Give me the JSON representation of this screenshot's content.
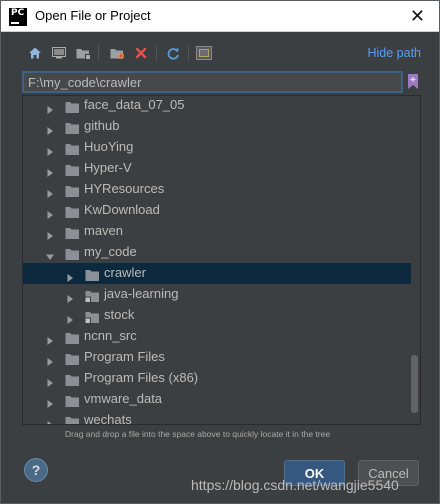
{
  "window": {
    "logo_text": "PC",
    "title": "Open File or Project"
  },
  "toolbar": {
    "icons": [
      "home-icon",
      "desktop-icon",
      "project-folder-icon",
      "new-folder-icon",
      "delete-icon",
      "refresh-icon",
      "toggle-hidden-icon"
    ],
    "hide_path_label": "Hide path"
  },
  "path": {
    "value": "F:\\my_code\\crawler"
  },
  "tree": {
    "rows": [
      {
        "label": "face_data_07_05",
        "expanded": false,
        "level": 1
      },
      {
        "label": "github",
        "expanded": false,
        "level": 1
      },
      {
        "label": "HuoYing",
        "expanded": false,
        "level": 1
      },
      {
        "label": "Hyper-V",
        "expanded": false,
        "level": 1
      },
      {
        "label": "HYResources",
        "expanded": false,
        "level": 1
      },
      {
        "label": "KwDownload",
        "expanded": false,
        "level": 1
      },
      {
        "label": "maven",
        "expanded": false,
        "level": 1
      },
      {
        "label": "my_code",
        "expanded": true,
        "level": 1
      },
      {
        "label": "crawler",
        "expanded": false,
        "level": 2,
        "selected": true
      },
      {
        "label": "java-learning",
        "expanded": false,
        "level": 2,
        "module": true
      },
      {
        "label": "stock",
        "expanded": false,
        "level": 2,
        "module": true
      },
      {
        "label": "ncnn_src",
        "expanded": false,
        "level": 1
      },
      {
        "label": "Program Files",
        "expanded": false,
        "level": 1
      },
      {
        "label": "Program Files (x86)",
        "expanded": false,
        "level": 1
      },
      {
        "label": "vmware_data",
        "expanded": false,
        "level": 1
      },
      {
        "label": "wechats",
        "expanded": false,
        "level": 1
      }
    ]
  },
  "hint_text": "Drag and drop a file into the space above to quickly locate it in the tree",
  "buttons": {
    "help": "?",
    "ok": "OK",
    "cancel": "Cancel"
  },
  "watermark": "https://blog.csdn.net/wangjie5540",
  "colors": {
    "background": "#3c3f41",
    "selection": "#0d293e",
    "link": "#589df6",
    "ok_button": "#365880",
    "folder": "#8b9096"
  }
}
